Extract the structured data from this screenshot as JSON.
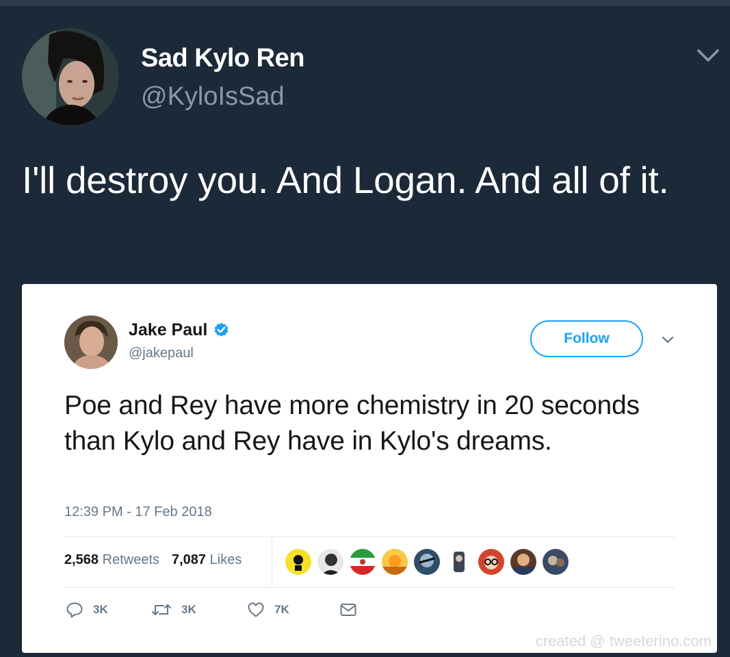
{
  "outer_tweet": {
    "display_name": "Sad Kylo Ren",
    "handle": "@KyloIsSad",
    "text": "I'll destroy you. And Logan. And all of it.",
    "avatar_icon": "profile-photo",
    "menu_icon": "chevron-down-icon"
  },
  "quoted_tweet": {
    "display_name": "Jake Paul",
    "verified_icon": "verified-badge-icon",
    "handle": "@jakepaul",
    "follow_label": "Follow",
    "text": "Poe and Rey have more chemistry in 20 seconds than Kylo and Rey have in Kylo's dreams.",
    "timestamp": "12:39 PM - 17 Feb 2018",
    "retweets_count": "2,568",
    "retweets_label": "Retweets",
    "likes_count": "7,087",
    "likes_label": "Likes",
    "liker_avatars": [
      "liker-1",
      "liker-2",
      "liker-3",
      "liker-4",
      "liker-5",
      "liker-6",
      "liker-7",
      "liker-8",
      "liker-9"
    ],
    "actions": {
      "reply_count": "3K",
      "retweet_count": "3K",
      "like_count": "7K"
    },
    "watermark": "created @ tweeterino.com"
  },
  "colors": {
    "background": "#1c2938",
    "accent": "#1da1f2",
    "secondary_text": "#8b98a5"
  }
}
